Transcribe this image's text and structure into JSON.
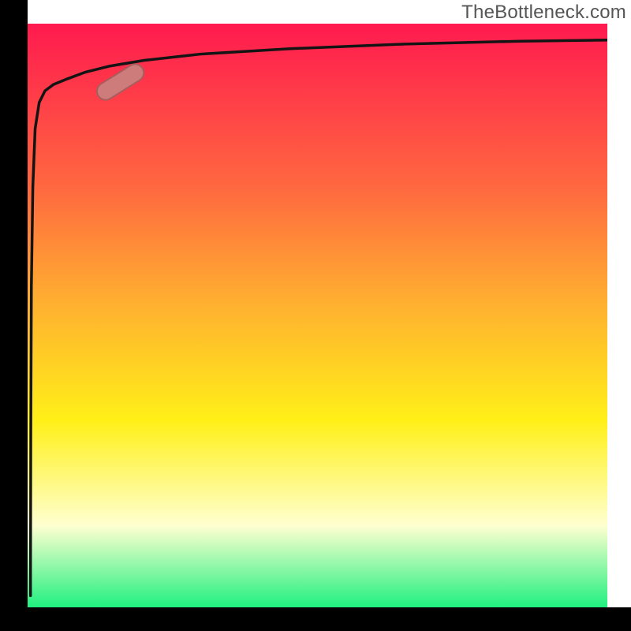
{
  "attribution": "TheBottleneck.com",
  "colors": {
    "frame": "#000000",
    "curve": "#141414",
    "marker_fill": "#ce7b7b",
    "marker_stroke": "#a85d5d",
    "gradient_top": "#ff1a4f",
    "gradient_mid1": "#ff6840",
    "gradient_mid2": "#ffb030",
    "gradient_mid3": "#fff018",
    "gradient_pale": "#ffffd0",
    "gradient_bottom": "#20f080"
  },
  "chart_data": {
    "type": "line",
    "title": "",
    "xlabel": "",
    "ylabel": "",
    "xlim": [
      0,
      1
    ],
    "ylim": [
      0,
      1
    ],
    "series": [
      {
        "name": "curve",
        "x": [
          0.005,
          0.0055,
          0.0065,
          0.009,
          0.013,
          0.02,
          0.03,
          0.045,
          0.07,
          0.1,
          0.14,
          0.2,
          0.3,
          0.45,
          0.65,
          0.85,
          1.0
        ],
        "y": [
          0.04,
          0.3,
          0.55,
          0.72,
          0.82,
          0.865,
          0.885,
          0.896,
          0.906,
          0.917,
          0.927,
          0.937,
          0.948,
          0.957,
          0.965,
          0.97,
          0.972
        ]
      }
    ],
    "marker": {
      "x": 0.16,
      "y": 0.9,
      "angle_deg": -32
    },
    "background": "vertical_gradient_red_to_green"
  }
}
